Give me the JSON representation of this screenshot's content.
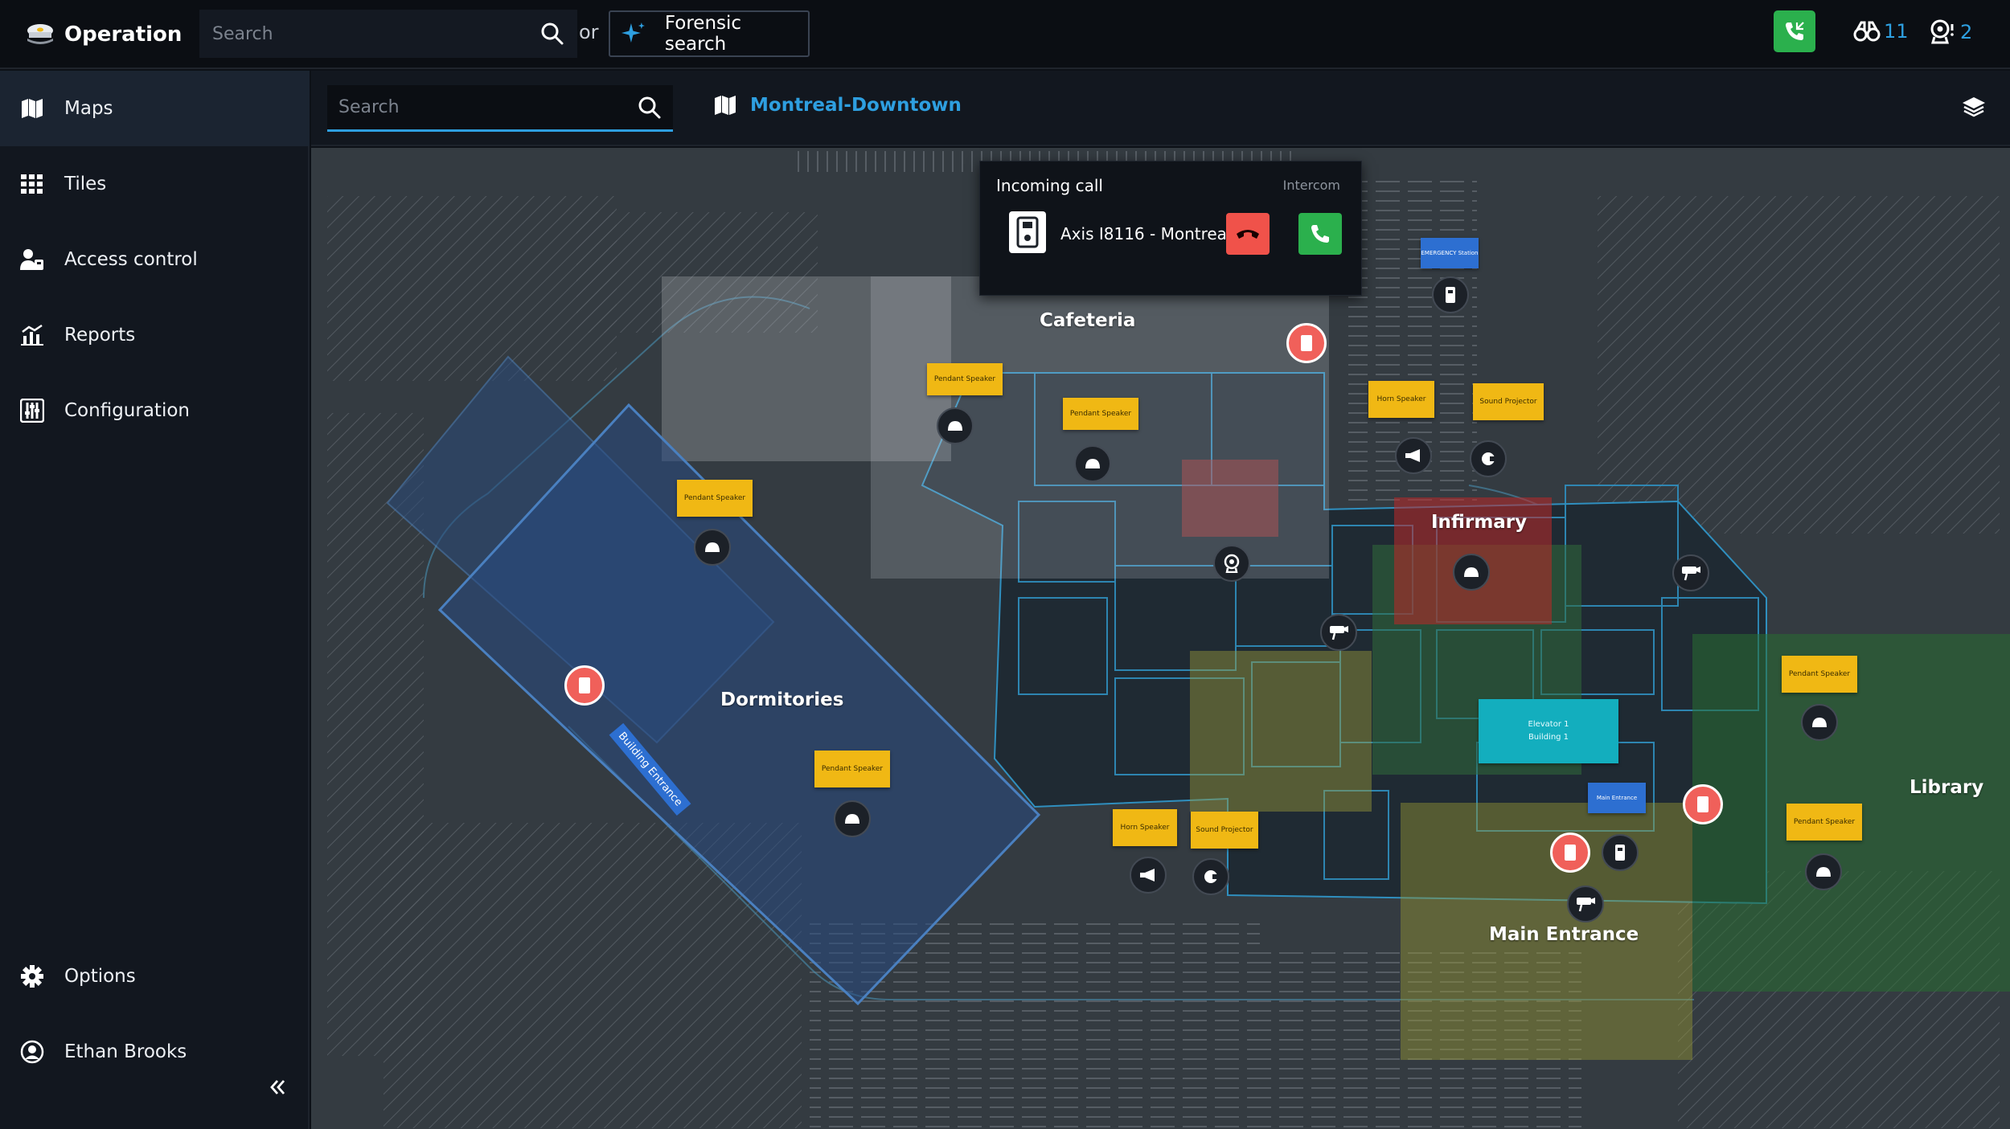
{
  "app": {
    "title": "Operation"
  },
  "top_search": {
    "placeholder": "Search"
  },
  "or_label": "or",
  "forensic_search": {
    "label": "Forensic search"
  },
  "status": {
    "alarm_count": "11",
    "camera_count": "2"
  },
  "sidebar": {
    "items": [
      {
        "label": "Maps",
        "icon": "map-icon",
        "active": true
      },
      {
        "label": "Tiles",
        "icon": "grid-icon"
      },
      {
        "label": "Access control",
        "icon": "users-icon"
      },
      {
        "label": "Reports",
        "icon": "chart-icon"
      },
      {
        "label": "Configuration",
        "icon": "sliders-icon"
      }
    ],
    "footer": [
      {
        "label": "Options",
        "icon": "gear-icon"
      },
      {
        "label": "Ethan Brooks",
        "icon": "user-circle-icon"
      }
    ]
  },
  "map_header": {
    "search_placeholder": "Search",
    "map_name": "Montreal-Downtown"
  },
  "incoming_call": {
    "title": "Incoming call",
    "type": "Intercom",
    "device": "Axis I8116 - Montreal"
  },
  "zones": {
    "cafeteria": "Cafeteria",
    "infirmary": "Infirmary",
    "dormitories": "Dormitories",
    "library": "Library",
    "main_entrance": "Main Entrance"
  },
  "tags": {
    "pendant_speaker": "Pendant Speaker",
    "horn_speaker": "Horn Speaker",
    "sound_projector": "Sound Projector",
    "emergency_station": "EMERGENCY Station",
    "main_entrance": "Main Entrance",
    "elevator_line1": "Elevator 1",
    "elevator_line2": "Building 1",
    "building_entrance": "Building Entrance"
  },
  "colors": {
    "accent": "#2e9fe0",
    "call_green": "#2bb04d",
    "call_red": "#f0524a",
    "tag_yellow": "#f0b814",
    "door_red": "#f0605a"
  }
}
